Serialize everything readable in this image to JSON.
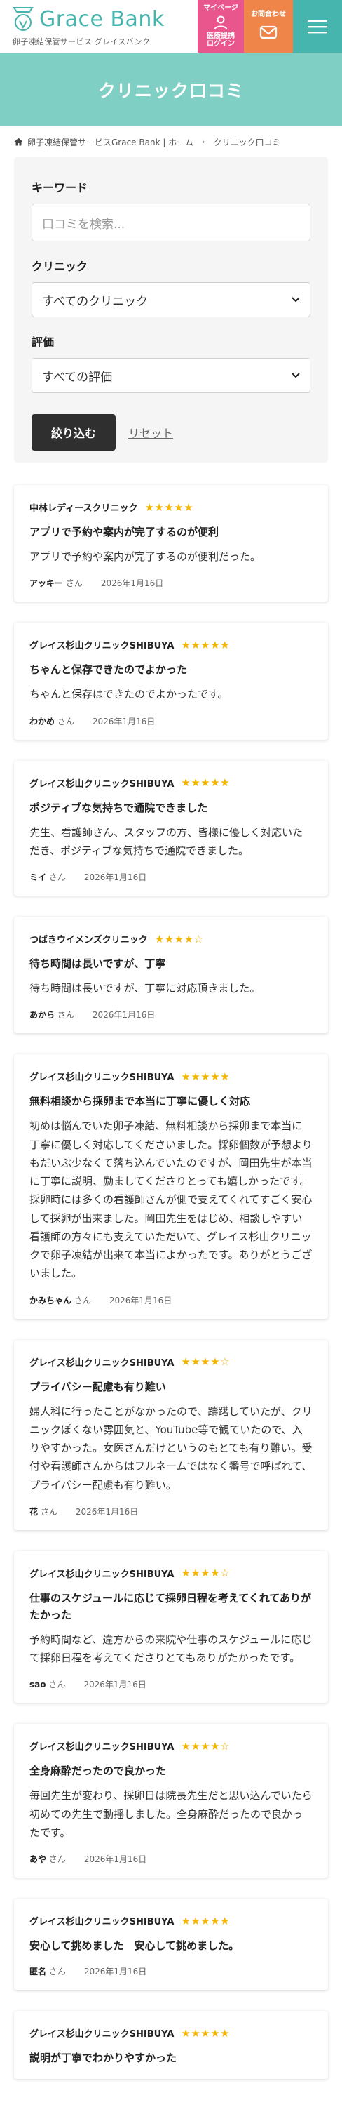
{
  "header": {
    "logo_title": "Grace Bank",
    "logo_sub": "卵子凍結保管サービス グレイスバンク",
    "mypage_line1": "マイページ",
    "mypage_line2": "医療提携",
    "mypage_line3": "ログイン",
    "contact_label": "お問合わせ",
    "menu_icon": "hamburger-icon",
    "colors": {
      "teal": "#45b5ae",
      "pink": "#e9568d",
      "orange": "#f0854a"
    }
  },
  "hero": {
    "title": "クリニック口コミ"
  },
  "breadcrumb": {
    "home": "卵子凍結保管サービスGrace Bank | ホーム",
    "current": "クリニック口コミ"
  },
  "filter": {
    "keyword_label": "キーワード",
    "keyword_placeholder": "口コミを検索...",
    "clinic_label": "クリニック",
    "clinic_selected": "すべてのクリニック",
    "rating_label": "評価",
    "rating_selected": "すべての評価",
    "submit_label": "絞り込む",
    "reset_label": "リセット"
  },
  "reviews": [
    {
      "clinic": "中林レディースクリニック",
      "stars": "★★★★★",
      "rating": 5,
      "title": "アプリで予約や案内が完了するのが便利",
      "body": "アプリで予約や案内が完了するのが便利だった。",
      "author": "アッキー",
      "suffix": "さん",
      "date": "2026年1月16日"
    },
    {
      "clinic": "グレイス杉山クリニックSHIBUYA",
      "stars": "★★★★★",
      "rating": 5,
      "title": "ちゃんと保存できたのでよかった",
      "body": "ちゃんと保存はできたのでよかったです。",
      "author": "わかめ",
      "suffix": "さん",
      "date": "2026年1月16日"
    },
    {
      "clinic": "グレイス杉山クリニックSHIBUYA",
      "stars": "★★★★★",
      "rating": 5,
      "title": "ポジティブな気持ちで通院できました",
      "body": "先生、看護師さん、スタッフの方、皆様に優しく対応いただき、ポジティブな気持ちで通院できました。",
      "author": "ミイ",
      "suffix": "さん",
      "date": "2026年1月16日"
    },
    {
      "clinic": "つばきウイメンズクリニック",
      "stars": "★★★★☆",
      "rating": 4,
      "title": "待ち時間は長いですが、丁寧",
      "body": "待ち時間は長いですが、丁寧に対応頂きました。",
      "author": "あから",
      "suffix": "さん",
      "date": "2026年1月16日"
    },
    {
      "clinic": "グレイス杉山クリニックSHIBUYA",
      "stars": "★★★★★",
      "rating": 5,
      "title": "無料相談から採卵まで本当に丁寧に優しく対応",
      "body": "初めは悩んでいた卵子凍結、無料相談から採卵まで本当に丁寧に優しく対応してくださいました。採卵個数が予想よりもだいぶ少なくて落ち込んでいたのですが、岡田先生が本当に丁寧に説明、励ましてくださりとっても嬉しかったです。採卵時には多くの看護師さんが側で支えてくれてすごく安心して採卵が出来ました。岡田先生をはじめ、相談しやすい看護師の方々にも支えていただいて、グレイス杉山クリニックで卵子凍結が出来て本当によかったです。ありがとうございました。",
      "author": "かみちゃん",
      "suffix": "さん",
      "date": "2026年1月16日"
    },
    {
      "clinic": "グレイス杉山クリニックSHIBUYA",
      "stars": "★★★★☆",
      "rating": 4,
      "title": "プライバシー配慮も有り難い",
      "body": "婦人科に行ったことがなかったので、躊躇していたが、クリニックぽくない雰囲気と、YouTube等で観ていたので、入りやすかった。女医さんだけというのもとても有り難い。受付や看護師さんからはフルネームではなく番号で呼ばれて、プライバシー配慮も有り難い。",
      "author": "花",
      "suffix": "さん",
      "date": "2026年1月16日"
    },
    {
      "clinic": "グレイス杉山クリニックSHIBUYA",
      "stars": "★★★★☆",
      "rating": 4,
      "title": "仕事のスケジュールに応じて採卵日程を考えてくれてありがたかった",
      "body": "予約時間など、違方からの来院や仕事のスケジュールに応じて採卵日程を考えてくださりとてもありがたかったです。",
      "author": "sao",
      "suffix": "さん",
      "date": "2026年1月16日"
    },
    {
      "clinic": "グレイス杉山クリニックSHIBUYA",
      "stars": "★★★★☆",
      "rating": 4,
      "title": "全身麻酔だったので良かった",
      "body": "毎回先生が変わり、採卵日は院長先生だと思い込んでいたら初めての先生で動揺しました。全身麻酔だったので良かったです。",
      "author": "あや",
      "suffix": "さん",
      "date": "2026年1月16日"
    },
    {
      "clinic": "グレイス杉山クリニックSHIBUYA",
      "stars": "★★★★★",
      "rating": 5,
      "title": "安心して挑めました　安心して挑めました。",
      "body": "",
      "author": "匿名",
      "suffix": "さん",
      "date": "2026年1月16日"
    },
    {
      "clinic": "グレイス杉山クリニックSHIBUYA",
      "stars": "★★★★★",
      "rating": 5,
      "title": "説明が丁寧でわかりやすかった",
      "body": "",
      "author": "",
      "suffix": "",
      "date": ""
    }
  ]
}
